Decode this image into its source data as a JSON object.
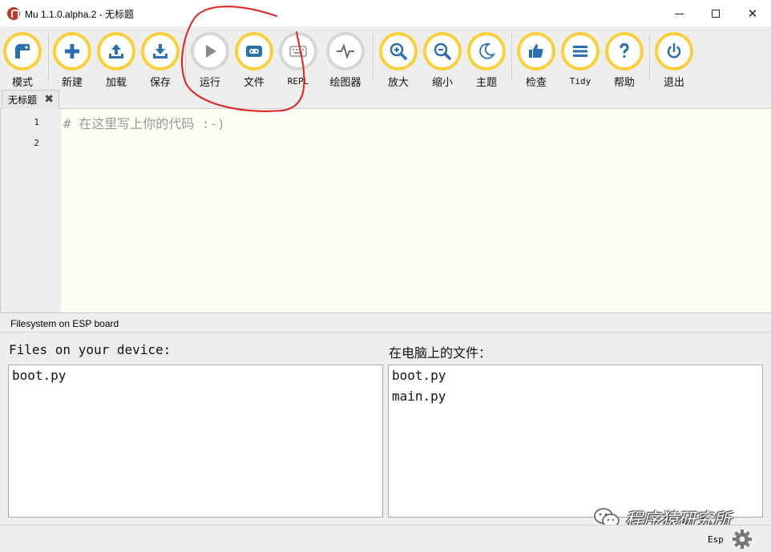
{
  "window": {
    "title": "Mu 1.1.0.alpha.2 - 无标题",
    "minimize": "minimize",
    "maximize": "maximize",
    "close": "✕"
  },
  "toolbar": {
    "buttons": [
      {
        "label": "模式",
        "icon": "mode-icon",
        "enabled": true
      },
      {
        "label": "新建",
        "icon": "plus-icon",
        "enabled": true
      },
      {
        "label": "加载",
        "icon": "upload-icon",
        "enabled": true
      },
      {
        "label": "保存",
        "icon": "download-icon",
        "enabled": true
      },
      {
        "label": "运行",
        "icon": "play-icon",
        "enabled": false
      },
      {
        "label": "文件",
        "icon": "device-icon",
        "enabled": true
      },
      {
        "label": "REPL",
        "icon": "keyboard-icon",
        "enabled": false
      },
      {
        "label": "绘图器",
        "icon": "pulse-icon",
        "enabled": false
      },
      {
        "label": "放大",
        "icon": "zoom-in-icon",
        "enabled": true
      },
      {
        "label": "缩小",
        "icon": "zoom-out-icon",
        "enabled": true
      },
      {
        "label": "主题",
        "icon": "moon-icon",
        "enabled": true
      },
      {
        "label": "检查",
        "icon": "thumbs-up-icon",
        "enabled": true
      },
      {
        "label": "Tidy",
        "icon": "lines-icon",
        "enabled": true
      },
      {
        "label": "帮助",
        "icon": "question-icon",
        "enabled": true
      },
      {
        "label": "退出",
        "icon": "power-icon",
        "enabled": true
      }
    ]
  },
  "tabs": [
    {
      "label": "无标题",
      "close": "✖"
    }
  ],
  "editor": {
    "line_numbers": [
      "1",
      "2"
    ],
    "lines": [
      "#  在这里写上你的代码 :-)",
      ""
    ]
  },
  "filesystem": {
    "header": "Filesystem on ESP board",
    "device_title": "Files on your device:",
    "device_files": [
      "boot.py"
    ],
    "computer_title": "在电脑上的文件：",
    "computer_files": [
      "boot.py",
      "main.py"
    ]
  },
  "statusbar": {
    "mode": "Esp"
  },
  "watermark": {
    "text": "程序猿研究所"
  },
  "colors": {
    "accent_ring": "#fad03a",
    "disabled_ring": "#d6d6d6",
    "icon_blue": "#2a6fb0",
    "editor_bg": "#fefdf4",
    "annotation": "#e02020"
  }
}
